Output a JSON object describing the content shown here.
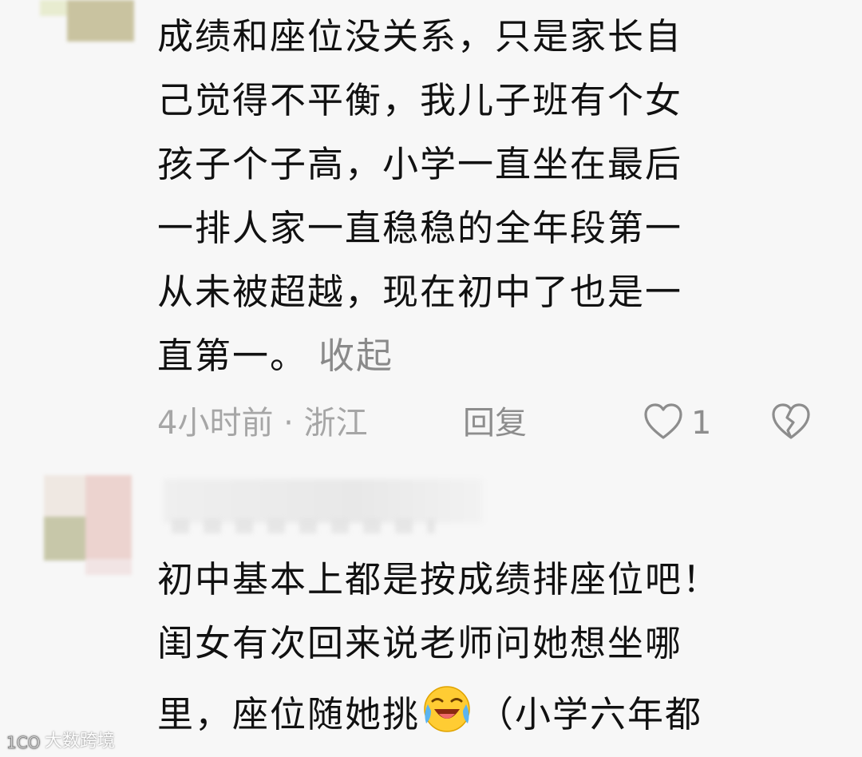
{
  "comment1": {
    "lines": [
      "成绩和座位没关系，只是家长自",
      "己觉得不平衡，我儿子班有个女",
      "孩子个子高，小学一直坐在最后",
      "一排人家一直稳稳的全年段第一",
      "从未被超越，现在初中了也是一",
      "直第一。"
    ],
    "collapse_label": "收起",
    "meta": "4小时前 · 浙江",
    "reply_label": "回复",
    "like_count": "1",
    "like_icon": "heart-outline-icon",
    "dislike_icon": "broken-heart-icon"
  },
  "comment2": {
    "lines": [
      "初中基本上都是按成绩排座位吧！",
      "闺女有次回来说老师问她想坐哪",
      "里，座位随她挑",
      "（小学六年都"
    ],
    "emoji": "laughing-crying-emoji"
  },
  "watermark": {
    "logo_text": "1CO",
    "text": "大数跨境"
  },
  "colors": {
    "background": "#f7f7f7",
    "text": "#111111",
    "meta": "#a6a6a6",
    "action": "#8d8d8d"
  }
}
